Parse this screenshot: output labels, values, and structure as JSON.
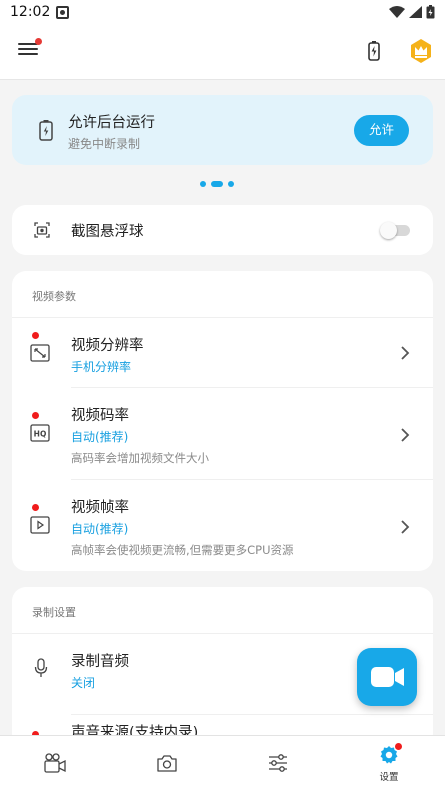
{
  "status_bar": {
    "time": "12:02"
  },
  "banner": {
    "title": "允许后台运行",
    "subtitle": "避免中断录制",
    "button": "允许"
  },
  "carousel": {
    "pages": 3,
    "active": 1
  },
  "floating_ball": {
    "label": "截图悬浮球",
    "enabled": false
  },
  "video_params": {
    "section_title": "视频参数",
    "resolution": {
      "title": "视频分辨率",
      "value": "手机分辨率"
    },
    "bitrate": {
      "title": "视频码率",
      "value": "自动(推荐)",
      "desc": "高码率会增加视频文件大小"
    },
    "framerate": {
      "title": "视频帧率",
      "value": "自动(推荐)",
      "desc": "高帧率会使视频更流畅,但需要更多CPU资源"
    }
  },
  "record_settings": {
    "section_title": "录制设置",
    "audio": {
      "title": "录制音频",
      "value": "关闭"
    },
    "source": {
      "title": "声音来源(支持内录)"
    }
  },
  "bottom_nav": {
    "settings_label": "设置"
  },
  "colors": {
    "accent": "#18a8e8",
    "badge": "#f01c1c",
    "banner_bg": "#e2f3fb"
  }
}
